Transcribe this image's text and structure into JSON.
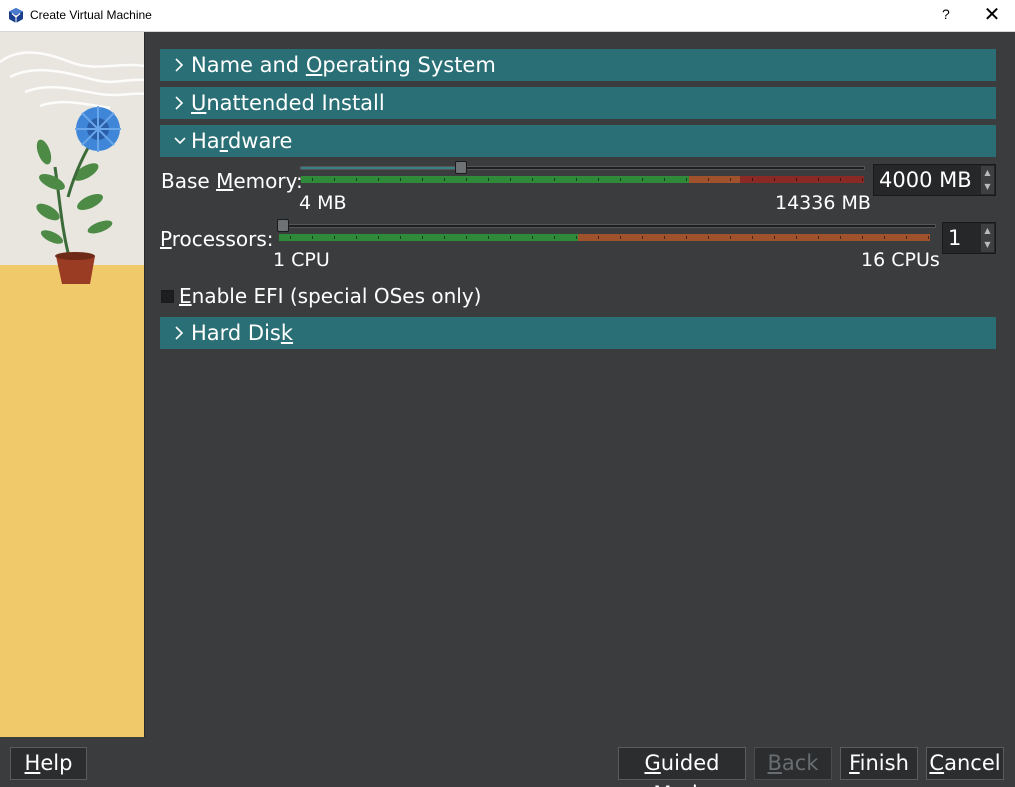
{
  "window": {
    "title": "Create Virtual Machine",
    "help_glyph": "?",
    "close_glyph": "✕"
  },
  "sections": {
    "name_os": {
      "label_pre": "Name and ",
      "label_u": "O",
      "label_post": "perating System",
      "state": "collapsed"
    },
    "unattended": {
      "label_pre": "",
      "label_u": "U",
      "label_post": "nattended Install",
      "state": "collapsed"
    },
    "hardware": {
      "label_pre": "Ha",
      "label_u": "r",
      "label_post": "dware",
      "state": "expanded"
    },
    "hard_disk": {
      "label_pre": "Hard Dis",
      "label_u": "k",
      "label_post": "",
      "state": "collapsed"
    }
  },
  "hardware": {
    "base_memory": {
      "label_pre": "Base ",
      "label_u": "M",
      "label_post": "emory:",
      "min_label": "4 MB",
      "max_label": "14336 MB",
      "value": "4000 MB",
      "value_fraction": 0.28,
      "ok_fraction": 0.69,
      "warn_fraction": 0.09,
      "bad_fraction": 0.22
    },
    "processors": {
      "label_pre": "",
      "label_u": "P",
      "label_post": "rocessors:",
      "min_label": "1 CPU",
      "max_label": "16 CPUs",
      "value": "1",
      "value_fraction": 0.0,
      "ok_fraction": 0.46,
      "warn_fraction": 0.54
    },
    "efi": {
      "label_pre": "",
      "label_u": "E",
      "label_post": "nable EFI (special OSes only)",
      "checked": false
    }
  },
  "buttons": {
    "help": {
      "label_u": "H",
      "label_post": "elp"
    },
    "guided": {
      "label_u": "G",
      "label_post": "uided Mode"
    },
    "back": {
      "label_u": "B",
      "label_post": "ack",
      "enabled": false
    },
    "finish": {
      "label_u": "F",
      "label_post": "inish"
    },
    "cancel": {
      "label_u": "C",
      "label_post": "ancel"
    }
  },
  "colors": {
    "section_header": "#2a6f75",
    "background": "#3a3c3e",
    "ok": "#2f8a3a",
    "warn": "#a0522d",
    "bad": "#8b2a25",
    "illustration_floor": "#efc96a"
  },
  "icons": [
    "virtualbox-icon",
    "chevron-right-icon",
    "chevron-down-icon",
    "spin-up-icon",
    "spin-down-icon"
  ]
}
